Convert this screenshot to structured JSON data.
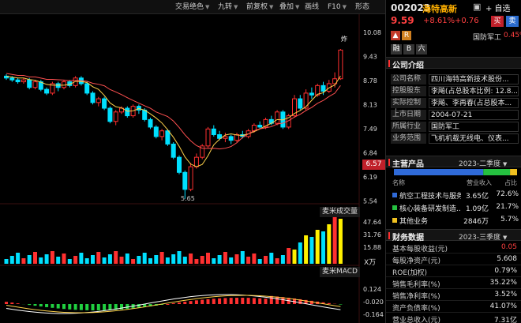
{
  "toolbar": {
    "items": [
      {
        "label": "交易绝色",
        "caret": true
      },
      {
        "label": "九转",
        "caret": true
      },
      {
        "label": "前复权",
        "caret": true
      },
      {
        "label": "叠加",
        "caret": true
      },
      {
        "label": "画线",
        "caret": false
      },
      {
        "label": "F10",
        "caret": true
      },
      {
        "label": "形态",
        "caret": false
      }
    ]
  },
  "chart": {
    "price_axis": [
      "10.08",
      "9.43",
      "8.78",
      "8.13",
      "7.49",
      "6.84",
      "6.19",
      "5.54"
    ],
    "current_price_tag": "6.57",
    "low_label": "5.65",
    "vol_title": "麦米成交量",
    "vol_axis": [
      "47.64",
      "31.76",
      "15.88"
    ],
    "vol_unit": "X万",
    "macd_title": "麦米MACD",
    "macd_axis": [
      "0.124",
      "-0.020",
      "-0.164"
    ],
    "top_marker": "炸",
    "colors": {
      "up": "#ff3030",
      "down": "#00e0ff",
      "ma1": "#ffd24a",
      "ma2": "#ff5050",
      "vol_up": "#ff3030",
      "vol_yellow": "#fff000"
    }
  },
  "stock": {
    "code": "002023",
    "name": "海特高新",
    "add_label": "+ 自选",
    "price": "9.59",
    "pct": "+8.61%",
    "chg": "+0.76",
    "buy": "买",
    "sell": "卖",
    "sector": "国防军工",
    "sector_pct": "0.45%",
    "tags": [
      "融",
      "B",
      "六"
    ]
  },
  "company": {
    "title": "公司介绍",
    "rows": [
      {
        "k": "公司名称",
        "v": "四川海特高新技术股份..."
      },
      {
        "k": "控股股东",
        "v": "李飚(占总股本比例: 12.8..."
      },
      {
        "k": "实际控制人",
        "v": "李飚、李再春(占总股本..."
      },
      {
        "k": "上市日期",
        "v": "2004-07-21"
      },
      {
        "k": "所属行业",
        "v": "国防军工"
      },
      {
        "k": "业务范围",
        "v": "飞机机载无线电、仪表..."
      }
    ]
  },
  "products": {
    "title": "主营产品",
    "period": "2023-二季度",
    "head": [
      "名称",
      "营业收入",
      "占比"
    ],
    "rows": [
      {
        "name": "航空工程技术与服务",
        "rev": "3.65亿",
        "pct": "72.6%",
        "color": "#2f6ad8"
      },
      {
        "name": "核心装备研发制造...",
        "rev": "1.09亿",
        "pct": "21.7%",
        "color": "#25c040"
      },
      {
        "name": "其他业务",
        "rev": "2846万",
        "pct": "5.7%",
        "color": "#f0c020"
      }
    ]
  },
  "finance": {
    "title": "财务数据",
    "period": "2023-三季度",
    "rows": [
      {
        "k": "基本每股收益(元)",
        "v": "0.05",
        "red": true
      },
      {
        "k": "每股净资产(元)",
        "v": "5.608"
      },
      {
        "k": "ROE(加权)",
        "v": "0.79%"
      },
      {
        "k": "销售毛利率(%)",
        "v": "35.22%"
      },
      {
        "k": "销售净利率(%)",
        "v": "3.52%"
      },
      {
        "k": "资产负债率(%)",
        "v": "41.07%"
      },
      {
        "k": "营业总收入(元)",
        "v": "7.31亿"
      }
    ]
  }
}
